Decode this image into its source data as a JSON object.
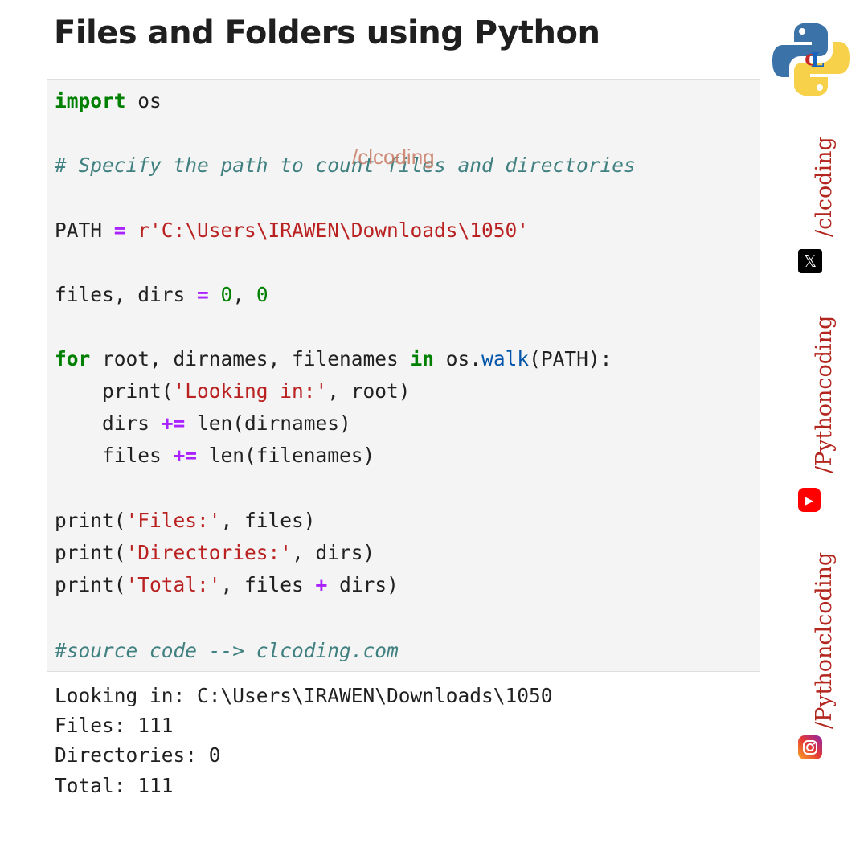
{
  "title": "Files and Folders using Python",
  "watermark": "/clcoding",
  "code": {
    "l1": {
      "kw": "import",
      "rest": " os"
    },
    "l2": "# Specify the path to count files and directories",
    "l3": {
      "a": "PATH ",
      "op": "=",
      "b": " ",
      "str": "r'C:\\Users\\IRAWEN\\Downloads\\1050'"
    },
    "l4": {
      "a": "files, dirs ",
      "op": "=",
      "b": " ",
      "n1": "0",
      "c": ", ",
      "n2": "0"
    },
    "l5": {
      "kw": "for",
      "a": " root, dirnames, filenames ",
      "kw2": "in",
      "b": " os.",
      "fn": "walk",
      "c": "(PATH):"
    },
    "l6": {
      "a": "    print(",
      "str": "'Looking in:'",
      "b": ", root)"
    },
    "l7": {
      "a": "    dirs ",
      "op": "+=",
      "b": " len(dirnames)"
    },
    "l8": {
      "a": "    files ",
      "op": "+=",
      "b": " len(filenames)"
    },
    "l9": {
      "a": "print(",
      "str": "'Files:'",
      "b": ", files)"
    },
    "l10": {
      "a": "print(",
      "str": "'Directories:'",
      "b": ", dirs)"
    },
    "l11": {
      "a": "print(",
      "str": "'Total:'",
      "b": ", files ",
      "op": "+",
      "c": " dirs)"
    },
    "l12": "#source code --> clcoding.com"
  },
  "output": [
    "Looking in: C:\\Users\\IRAWEN\\Downloads\\1050",
    "Files: 111",
    "Directories: 0",
    "Total: 111"
  ],
  "sidebar": {
    "logo_icon": "python-logo",
    "handles": [
      {
        "text": "/clcoding",
        "icon": "x-icon"
      },
      {
        "text": "/Pythoncoding",
        "icon": "youtube-icon"
      },
      {
        "text": "/Pythonclcoding",
        "icon": "instagram-icon"
      }
    ]
  },
  "colors": {
    "keyword": "#008000",
    "operator": "#aa22ff",
    "string": "#ba2121",
    "comment": "#408080",
    "handle": "#b3261e"
  }
}
